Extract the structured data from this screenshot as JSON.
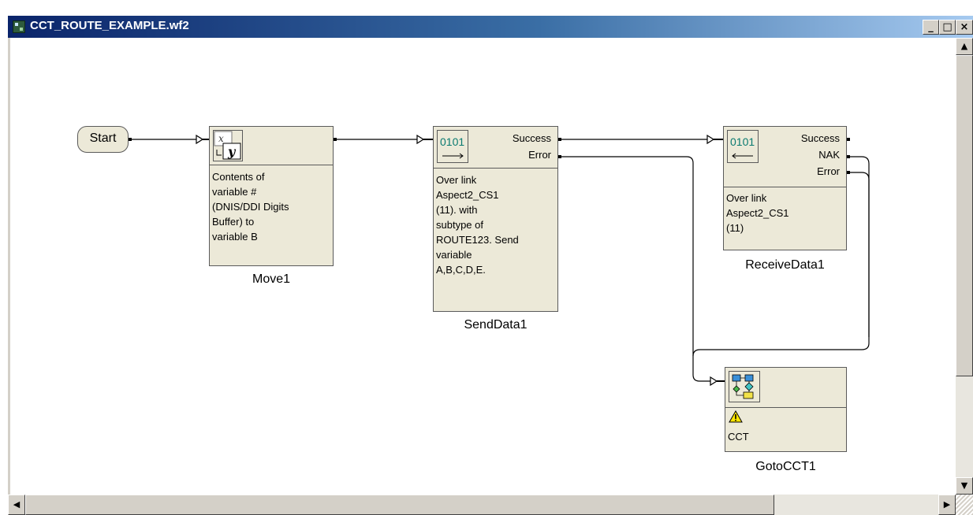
{
  "window": {
    "title": "CCT_ROUTE_EXAMPLE.wf2",
    "controls": {
      "minimize": "_",
      "maximize": "□",
      "close": "×"
    }
  },
  "start": {
    "label": "Start"
  },
  "nodes": {
    "move1": {
      "name": "Move1",
      "icon": "move-variable-icon",
      "desc": [
        "Contents of",
        "variable #",
        "(DNIS/DDI Digits",
        "Buffer) to",
        "variable B"
      ]
    },
    "send1": {
      "name": "SendData1",
      "icon": "send-data-icon",
      "icon_text": "0101",
      "ports": [
        "Success",
        "Error"
      ],
      "desc": [
        "Over link",
        "Aspect2_CS1",
        "(11). with",
        "subtype of",
        "ROUTE123. Send",
        "variable",
        "A,B,C,D,E."
      ]
    },
    "recv1": {
      "name": "ReceiveData1",
      "icon": "receive-data-icon",
      "icon_text": "0101",
      "ports": [
        "Success",
        "NAK",
        "Error"
      ],
      "desc": [
        "Over link",
        "Aspect2_CS1",
        "(11)"
      ]
    },
    "goto1": {
      "name": "GotoCCT1",
      "icon": "goto-cct-icon",
      "warning_icon": "warning-icon",
      "desc": [
        "CCT"
      ]
    }
  },
  "colors": {
    "titlebar_start": "#0a246a",
    "titlebar_end": "#a6caf0",
    "node_fill": "#ece9d8",
    "chrome": "#d4d0c8"
  }
}
